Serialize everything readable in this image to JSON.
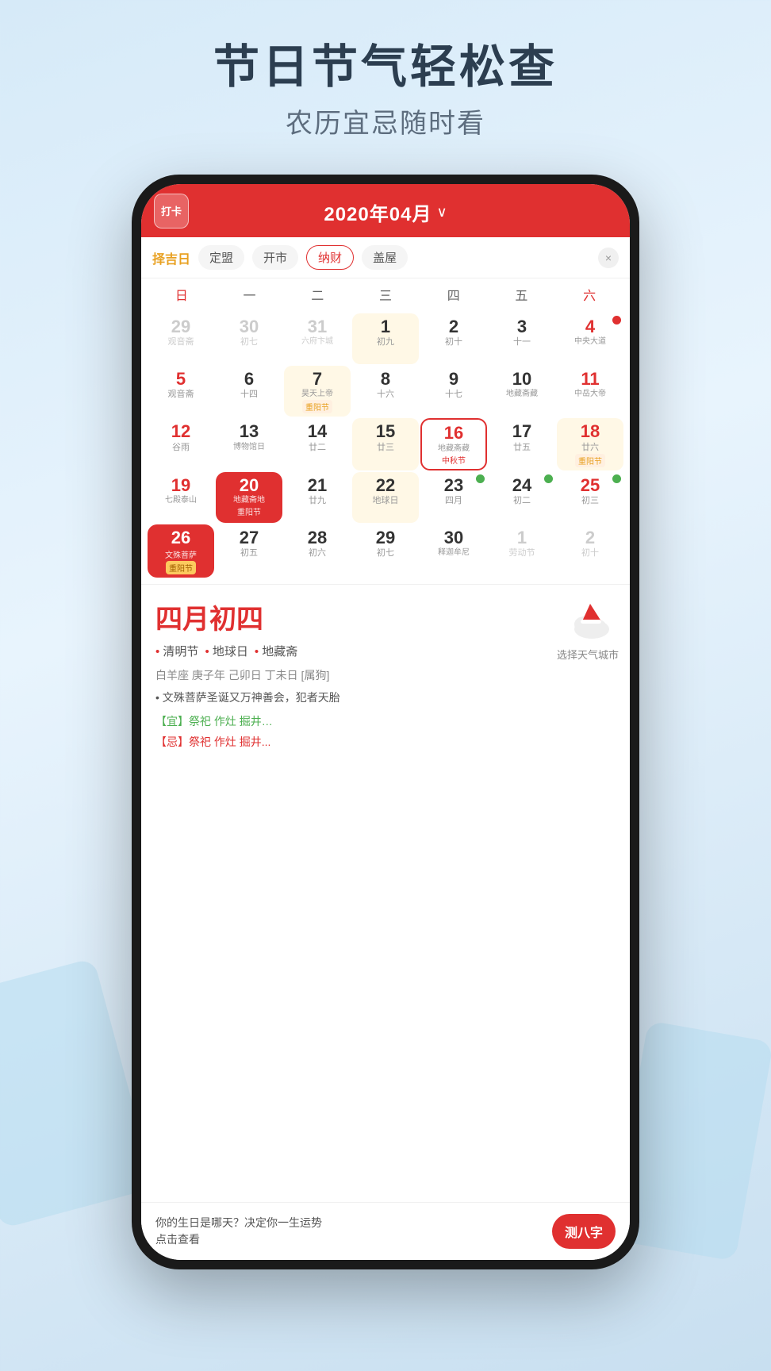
{
  "header": {
    "title": "节日节气轻松查",
    "subtitle": "农历宜忌随时看"
  },
  "phone": {
    "cal_header": {
      "checkin_label": "打卡",
      "month_title": "2020年04月",
      "arrow": "∨"
    },
    "filter": {
      "label": "择吉日",
      "tags": [
        "定盟",
        "开市",
        "纳财",
        "盖屋"
      ],
      "active_tag": "纳财",
      "close": "×"
    },
    "weekdays": [
      "日",
      "一",
      "二",
      "三",
      "四",
      "五",
      "六"
    ],
    "weeks": [
      [
        {
          "num": "29",
          "lunar": "观音斋",
          "type": "prev",
          "highlight": false
        },
        {
          "num": "30",
          "lunar": "初七",
          "type": "prev",
          "highlight": false
        },
        {
          "num": "31",
          "lunar": "六府卞城",
          "type": "prev",
          "highlight": false
        },
        {
          "num": "1",
          "lunar": "初九",
          "type": "normal",
          "highlight": true
        },
        {
          "num": "2",
          "lunar": "初十",
          "type": "normal",
          "highlight": false
        },
        {
          "num": "3",
          "lunar": "十一",
          "type": "normal",
          "highlight": false
        },
        {
          "num": "4",
          "lunar": "中央大道",
          "type": "saturday",
          "highlight": false,
          "badge": true
        }
      ],
      [
        {
          "num": "5",
          "lunar": "观音斋",
          "type": "sunday",
          "highlight": false
        },
        {
          "num": "6",
          "lunar": "十四",
          "type": "normal",
          "highlight": false
        },
        {
          "num": "7",
          "lunar": "昊天上帝",
          "sub": "重阳节",
          "type": "normal",
          "highlight": true
        },
        {
          "num": "8",
          "lunar": "十六",
          "type": "normal",
          "highlight": false
        },
        {
          "num": "9",
          "lunar": "十七",
          "type": "normal",
          "highlight": false
        },
        {
          "num": "10",
          "lunar": "地藏斋藏",
          "type": "normal",
          "highlight": false
        },
        {
          "num": "11",
          "lunar": "中岳大帝",
          "type": "saturday",
          "highlight": false
        }
      ],
      [
        {
          "num": "12",
          "lunar": "谷雨",
          "type": "sunday",
          "highlight": false
        },
        {
          "num": "13",
          "lunar": "博物馆日",
          "type": "normal",
          "highlight": false
        },
        {
          "num": "14",
          "lunar": "廿二",
          "type": "normal",
          "highlight": false
        },
        {
          "num": "15",
          "lunar": "廿三",
          "type": "normal",
          "highlight": true
        },
        {
          "num": "16",
          "lunar": "地藏斋藏",
          "sub": "中秋节",
          "type": "today-outline",
          "highlight": false
        },
        {
          "num": "17",
          "lunar": "廿五",
          "type": "normal",
          "highlight": false
        },
        {
          "num": "18",
          "lunar": "廿六",
          "sub": "重阳节",
          "type": "saturday",
          "highlight": true
        }
      ],
      [
        {
          "num": "19",
          "lunar": "七殿泰山",
          "type": "sunday",
          "highlight": false
        },
        {
          "num": "20",
          "lunar": "地藏斋地",
          "sub": "重阳节",
          "type": "selected",
          "highlight": false
        },
        {
          "num": "21",
          "lunar": "廿九",
          "type": "normal",
          "highlight": false
        },
        {
          "num": "22",
          "lunar": "地球日",
          "type": "normal",
          "highlight": true
        },
        {
          "num": "23",
          "lunar": "四月",
          "type": "normal",
          "highlight": false,
          "badge_green": true
        },
        {
          "num": "24",
          "lunar": "初二",
          "type": "normal",
          "highlight": false,
          "badge_green": true
        },
        {
          "num": "25",
          "lunar": "初三",
          "type": "saturday",
          "highlight": false,
          "badge_green": true
        }
      ],
      [
        {
          "num": "26",
          "lunar": "文殊菩萨",
          "sub": "重阳节",
          "type": "sunday-selected",
          "highlight": false
        },
        {
          "num": "27",
          "lunar": "初五",
          "type": "normal",
          "highlight": false
        },
        {
          "num": "28",
          "lunar": "初六",
          "type": "normal",
          "highlight": false
        },
        {
          "num": "29",
          "lunar": "初七",
          "type": "normal",
          "highlight": false
        },
        {
          "num": "30",
          "lunar": "释迦牟尼",
          "type": "normal",
          "highlight": false
        },
        {
          "num": "1",
          "lunar": "劳动节",
          "type": "next",
          "highlight": false
        },
        {
          "num": "2",
          "lunar": "初十",
          "type": "next",
          "highlight": false
        }
      ]
    ],
    "detail": {
      "date": "四月初四",
      "tags": [
        "清明节",
        "地球日",
        "地藏斋"
      ],
      "zodiac": "白羊座 庚子年 己卯日 丁未日 [属狗]",
      "note": "• 文殊菩萨圣诞又万神善会，犯者天胎",
      "yi": "【宜】祭祀 作灶 掘井…",
      "ji": "【忌】祭祀 作灶 掘井...",
      "weather_label": "选择天气城市"
    },
    "fortune": {
      "text_line1": "你的生日是哪天？决定你一生运势",
      "text_line2": "点击查看",
      "button": "测八字"
    }
  }
}
